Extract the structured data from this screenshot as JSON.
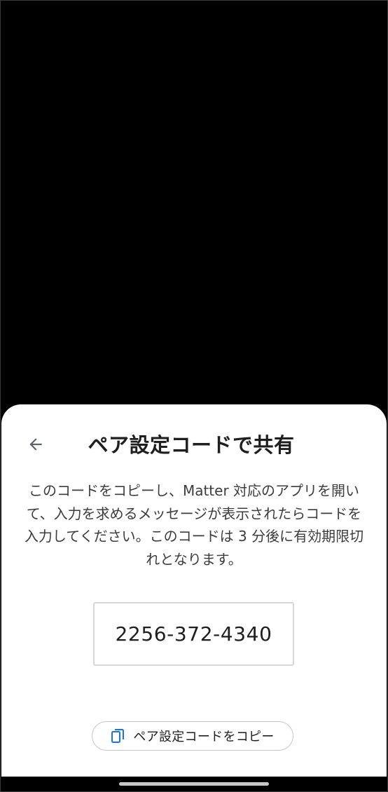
{
  "sheet": {
    "title": "ペア設定コードで共有",
    "description": "このコードをコピーし、Matter 対応のアプリを開いて、入力を求めるメッセージが表示されたらコードを入力してください。このコードは 3 分後に有効期限切れとなります。",
    "pairing_code": "2256-372-4340",
    "copy_button_label": "ペア設定コードをコピー"
  },
  "icons": {
    "back": "arrow-back-icon",
    "copy": "content-copy-icon"
  },
  "colors": {
    "accent": "#1a73e8",
    "text_primary": "#1f1f1f",
    "text_secondary": "#3c3c3c",
    "backdrop": "#000000",
    "sheet_background": "#ffffff"
  }
}
